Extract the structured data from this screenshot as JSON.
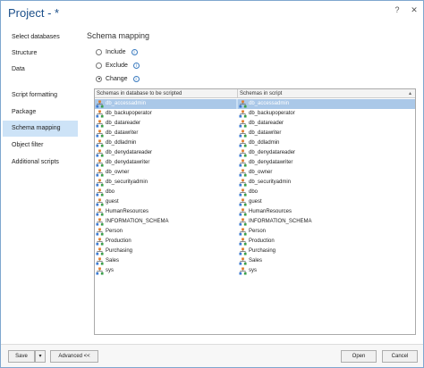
{
  "window": {
    "title": "Project - *"
  },
  "sidebar": {
    "items": [
      {
        "label": "Select databases"
      },
      {
        "label": "Structure"
      },
      {
        "label": "Data"
      },
      {
        "label": "Script formatting"
      },
      {
        "label": "Package"
      },
      {
        "label": "Schema mapping"
      },
      {
        "label": "Object filter"
      },
      {
        "label": "Additional scripts"
      }
    ]
  },
  "main": {
    "heading": "Schema mapping",
    "options": [
      {
        "label": "Include",
        "checked": false
      },
      {
        "label": "Exclude",
        "checked": false
      },
      {
        "label": "Change",
        "checked": true
      }
    ],
    "grid": {
      "columns": [
        "Schemas in database to be scripted",
        "Schemas in script"
      ],
      "rows": [
        [
          "db_accessadmin",
          "db_accessadmin"
        ],
        [
          "db_backupoperator",
          "db_backupoperator"
        ],
        [
          "db_datareader",
          "db_datareader"
        ],
        [
          "db_datawriter",
          "db_datawriter"
        ],
        [
          "db_ddladmin",
          "db_ddladmin"
        ],
        [
          "db_denydatareader",
          "db_denydatareader"
        ],
        [
          "db_denydatawriter",
          "db_denydatawriter"
        ],
        [
          "db_owner",
          "db_owner"
        ],
        [
          "db_securityadmin",
          "db_securityadmin"
        ],
        [
          "dbo",
          "dbo"
        ],
        [
          "guest",
          "guest"
        ],
        [
          "HumanResources",
          "HumanResources"
        ],
        [
          "INFORMATION_SCHEMA",
          "INFORMATION_SCHEMA"
        ],
        [
          "Person",
          "Person"
        ],
        [
          "Production",
          "Production"
        ],
        [
          "Purchasing",
          "Purchasing"
        ],
        [
          "Sales",
          "Sales"
        ],
        [
          "sys",
          "sys"
        ]
      ]
    }
  },
  "footer": {
    "save_label": "Save",
    "advanced_label": "Advanced <<",
    "open_label": "Open",
    "cancel_label": "Cancel"
  },
  "icons": {
    "schema": "schema-icon",
    "info": "info-icon",
    "help": "help-icon",
    "close": "close-icon",
    "dropdown": "chevron-down-icon"
  },
  "colors": {
    "accent": "#1b4f8a",
    "selection": "#cde3f7",
    "selected_row": "#aac8e8"
  }
}
